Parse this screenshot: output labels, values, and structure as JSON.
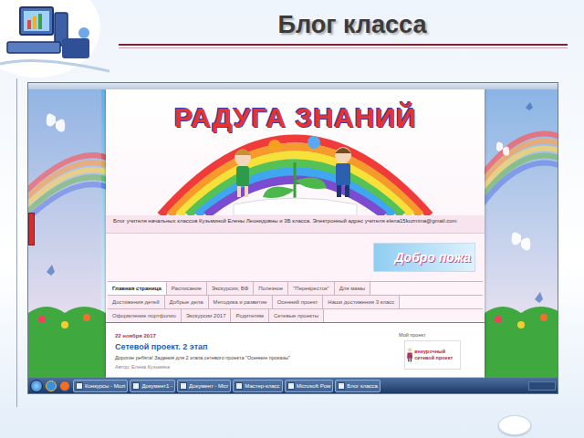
{
  "slide": {
    "title": "Блог класса"
  },
  "blog": {
    "header_title": "РАДУГА ЗНАНИЙ",
    "description": "Блог учителя начальных классов Кузьминой Елены Леонидовны и 3Б класса. Электронный адрес учителя elena15kuzmina@gmail.com",
    "welcome": "Добро пожа"
  },
  "nav": {
    "rows": [
      [
        {
          "label": "Главная страница",
          "selected": true
        },
        {
          "label": "Расписание",
          "selected": false
        },
        {
          "label": "Экскурсии, ВФ",
          "selected": false
        },
        {
          "label": "Полезное",
          "selected": false
        },
        {
          "label": "\"Перекресток\"",
          "selected": false
        },
        {
          "label": "Для мамы",
          "selected": false
        }
      ],
      [
        {
          "label": "Достижения детей",
          "selected": false
        },
        {
          "label": "Добрые дела",
          "selected": false
        },
        {
          "label": "Методика и развитие",
          "selected": false
        },
        {
          "label": "Осенний проект",
          "selected": false
        },
        {
          "label": "Наши достижения 3 класс",
          "selected": false
        }
      ],
      [
        {
          "label": "Оформление портфолио",
          "selected": false
        },
        {
          "label": "Экскурсии 2017",
          "selected": false
        },
        {
          "label": "Родителям",
          "selected": false
        },
        {
          "label": "Сетевые проекты",
          "selected": false
        }
      ]
    ]
  },
  "post": {
    "date": "22 ноября 2017",
    "title": "Сетевой проект. 2 этап",
    "text": "Дорогие ребята! Задания для 2 этапа сетевого проекта \"Осенние проказы\"",
    "author": "Автор: Елена Кузьмина"
  },
  "sidebar": {
    "title": "Мой проект",
    "badge": "внеурочный сетевой проект"
  },
  "taskbar": [
    {
      "label": "Конкурсы - Mozi"
    },
    {
      "label": "Документ1 -"
    },
    {
      "label": "Документ - Micr"
    },
    {
      "label": "Мастер-класс"
    },
    {
      "label": "Microsoft Pow"
    },
    {
      "label": "Блог класса"
    }
  ]
}
